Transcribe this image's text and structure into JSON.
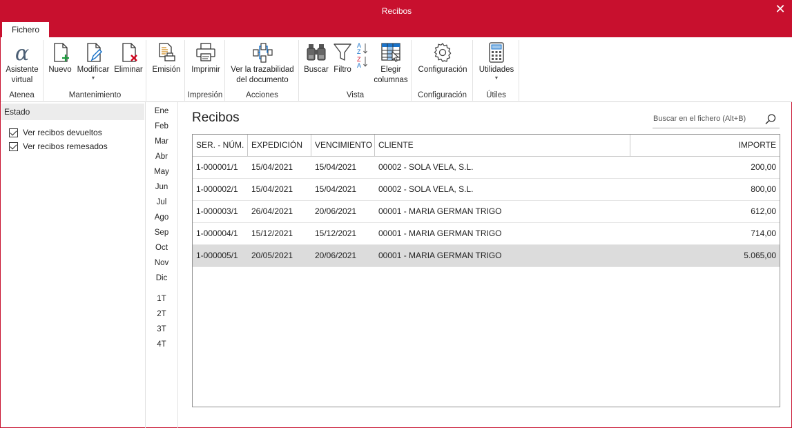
{
  "window": {
    "title": "Recibos",
    "close_label": "✕"
  },
  "tabs": [
    {
      "label": "Fichero"
    }
  ],
  "ribbon": {
    "groups": [
      {
        "label": "Atenea",
        "buttons": [
          {
            "label": "Asistente virtual",
            "icon": "alpha-icon"
          }
        ]
      },
      {
        "label": "Mantenimiento",
        "buttons": [
          {
            "label": "Nuevo",
            "icon": "new-document-icon"
          },
          {
            "label": "Modificar",
            "icon": "edit-document-icon",
            "dropdown": true
          },
          {
            "label": "Eliminar",
            "icon": "delete-document-icon"
          }
        ]
      },
      {
        "label": "",
        "buttons": [
          {
            "label": "Emisión",
            "icon": "emission-icon"
          }
        ]
      },
      {
        "label": "Impresión",
        "buttons": [
          {
            "label": "Imprimir",
            "icon": "printer-icon"
          }
        ]
      },
      {
        "label": "Acciones",
        "buttons": [
          {
            "label": "Ver la trazabilidad del documento",
            "icon": "traceability-icon"
          }
        ]
      },
      {
        "label": "Vista",
        "buttons": [
          {
            "label": "Buscar",
            "icon": "binoculars-icon"
          },
          {
            "label": "Filtro",
            "icon": "filter-icon"
          },
          {
            "label": "",
            "icon": "sort-az-icon"
          },
          {
            "label": "Elegir columnas",
            "icon": "columns-icon"
          }
        ]
      },
      {
        "label": "Configuración",
        "buttons": [
          {
            "label": "Configuración",
            "icon": "gear-icon"
          }
        ]
      },
      {
        "label": "Útiles",
        "buttons": [
          {
            "label": "Utilidades",
            "icon": "calculator-icon",
            "dropdown": true
          }
        ]
      }
    ]
  },
  "sidebar": {
    "header": "Estado",
    "checkboxes": [
      {
        "label": "Ver recibos devueltos",
        "checked": true
      },
      {
        "label": "Ver recibos remesados",
        "checked": true
      }
    ]
  },
  "months": [
    "Ene",
    "Feb",
    "Mar",
    "Abr",
    "May",
    "Jun",
    "Jul",
    "Ago",
    "Sep",
    "Oct",
    "Nov",
    "Dic"
  ],
  "quarters": [
    "1T",
    "2T",
    "3T",
    "4T"
  ],
  "main": {
    "title": "Recibos",
    "search_placeholder": "Buscar en el fichero (Alt+B)",
    "columns": [
      "SER. - NÚM.",
      "EXPEDICIÓN",
      "VENCIMIENTO",
      "CLIENTE",
      "IMPORTE"
    ],
    "rows": [
      [
        "1-000001/1",
        "15/04/2021",
        "15/04/2021",
        "00002 - SOLA VELA, S.L.",
        "200,00"
      ],
      [
        "1-000002/1",
        "15/04/2021",
        "15/04/2021",
        "00002 - SOLA VELA, S.L.",
        "800,00"
      ],
      [
        "1-000003/1",
        "26/04/2021",
        "20/06/2021",
        "00001 - MARIA GERMAN TRIGO",
        "612,00"
      ],
      [
        "1-000004/1",
        "15/12/2021",
        "15/12/2021",
        "00001 - MARIA GERMAN TRIGO",
        "714,00"
      ],
      [
        "1-000005/1",
        "20/05/2021",
        "20/06/2021",
        "00001 - MARIA GERMAN TRIGO",
        "5.065,00"
      ]
    ],
    "selected_row": 4
  },
  "colors": {
    "accent": "#c8102e",
    "selected_row": "#dcdcdc",
    "icon_green": "#1a9b3c",
    "icon_red": "#d0021b",
    "icon_blue": "#1a73c9"
  }
}
